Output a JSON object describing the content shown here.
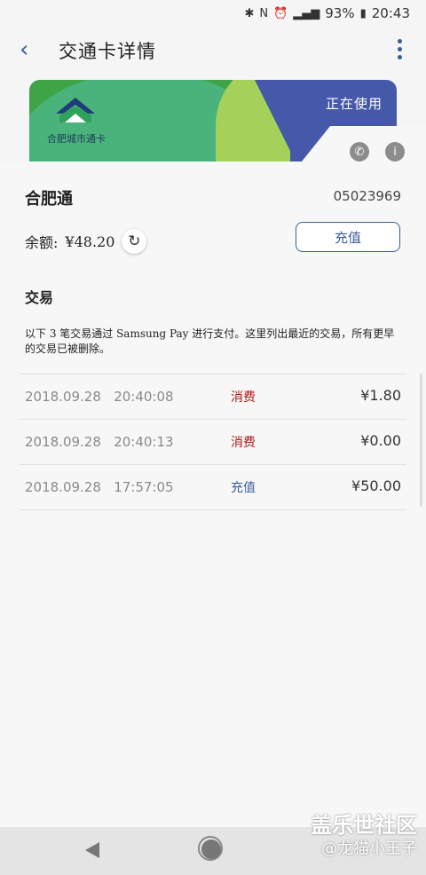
{
  "status_bar": {
    "battery": "93%",
    "time": "20:43"
  },
  "header": {
    "title": "交通卡详情"
  },
  "card": {
    "name": "合肥城市通卡",
    "status": "正在使用"
  },
  "detail": {
    "place": "合肥通",
    "card_number": "05023969",
    "balance_label": "余额:",
    "balance_value": "¥48.20",
    "topup_label": "充值"
  },
  "transactions": {
    "heading": "交易",
    "note": "以下 3 笔交易通过 Samsung Pay 进行支付。这里列出最近的交易，所有更早的交易已被删除。",
    "rows": [
      {
        "date": "2018.09.28",
        "time": "20:40:08",
        "type": "消费",
        "amount": "¥1.80"
      },
      {
        "date": "2018.09.28",
        "time": "20:40:13",
        "type": "消费",
        "amount": "¥0.00"
      },
      {
        "date": "2018.09.28",
        "time": "17:57:05",
        "type": "充值",
        "amount": "¥50.00"
      }
    ]
  },
  "watermark": {
    "line1": "盖乐世社区",
    "line2": "@龙猫小王子"
  },
  "colors": {
    "accent": "#3b5c9a",
    "expense": "#b01818",
    "topup": "#3b5c9a"
  }
}
